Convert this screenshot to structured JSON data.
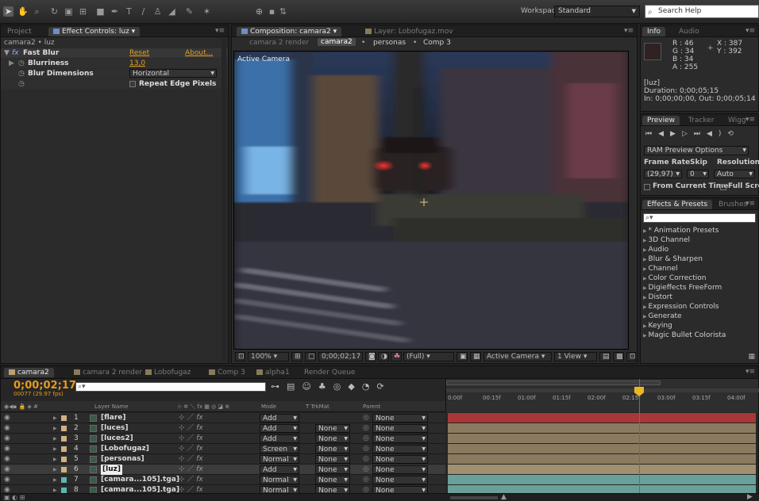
{
  "toolbar": {
    "tools": [
      "arrow-tool",
      "hand-tool",
      "zoom-tool",
      "rotate-tool",
      "camera-tool",
      "pan-tool",
      "rect-tool",
      "pen-tool",
      "type-tool",
      "brush-tool",
      "stamp-tool",
      "eraser-tool",
      "puppet-tool"
    ],
    "workspace_label": "Workspace:",
    "workspace_value": "Standard",
    "search_placeholder": "Search Help"
  },
  "effect_controls": {
    "tab_project": "Project",
    "tab_title": "Effect Controls: luz",
    "layer_path": "camara2 • luz",
    "effect_name": "Fast Blur",
    "reset": "Reset",
    "about": "About...",
    "prop1_name": "Blurriness",
    "prop1_value": "13,0",
    "prop2_name": "Blur Dimensions",
    "prop2_value": "Horizontal",
    "prop3_name": "Repeat Edge Pixels"
  },
  "composition": {
    "tab_title": "Composition: camara2",
    "tab_layer": "Layer: Lobofugaz.mov",
    "crumbs": [
      "camara 2 render",
      "camara2",
      "personas",
      "Comp 3"
    ],
    "active_camera_label": "Active Camera",
    "zoom": "100%",
    "timecode": "0;00;02;17",
    "resolution": "(Full)",
    "camera_view": "Active Camera",
    "views": "1 View"
  },
  "info": {
    "tab_info": "Info",
    "tab_audio": "Audio",
    "r": "R : 46",
    "g": "G : 34",
    "b": "B : 34",
    "a": "A : 255",
    "x": "X : 387",
    "y": "Y : 392",
    "layer": "[luz]",
    "duration": "Duration: 0;00;05;15",
    "inout": "In: 0;00;00;00, Out: 0;00;05;14",
    "swatch": "#2e2222"
  },
  "preview": {
    "tab_preview": "Preview",
    "tab_tracker": "Tracker",
    "tab_wiggler": "Wigg",
    "ram_options": "RAM Preview Options",
    "frame_rate_label": "Frame Rate",
    "skip_label": "Skip",
    "resolution_label": "Resolution",
    "frame_rate": "(29,97)",
    "skip": "0",
    "resolution": "Auto",
    "from_current": "From Current Time",
    "full_screen": "Full Scree"
  },
  "effects": {
    "tab_effects": "Effects & Presets",
    "tab_brushes": "Brushes",
    "items": [
      "* Animation Presets",
      "3D Channel",
      "Audio",
      "Blur & Sharpen",
      "Channel",
      "Color Correction",
      "Digieffects FreeForm",
      "Distort",
      "Expression Controls",
      "Generate",
      "Keying",
      "Magic Bullet Colorista"
    ]
  },
  "timeline": {
    "tabs": [
      "camara2",
      "camara 2 render",
      "Lobofugaz",
      "Comp 3",
      "alpha1",
      "Render Queue"
    ],
    "tab_colors": [
      "#b8a070",
      "#8a7a5a",
      "#8a7a5a",
      "#8a7a5a",
      "#8a7a5a",
      ""
    ],
    "timecode": "0;00;02;17",
    "frame_info": "00077 (29.97 fps)",
    "col_layer_name": "Layer Name",
    "col_mode": "Mode",
    "col_trkmat": "T  TrkMat",
    "col_parent": "Parent",
    "ruler": [
      "0:00f",
      "00:15f",
      "01:00f",
      "01:15f",
      "02:00f",
      "02:15f",
      "03:00f",
      "03:15f",
      "04:00f"
    ],
    "layers": [
      {
        "num": "1",
        "name": "[flare]",
        "mode": "Add",
        "trkmat": "",
        "parent": "None",
        "color": "#d0b080",
        "bar": "#a83838"
      },
      {
        "num": "2",
        "name": "[luces]",
        "mode": "Add",
        "trkmat": "None",
        "parent": "None",
        "color": "#d0b080",
        "bar": "#8a7a60"
      },
      {
        "num": "3",
        "name": "[luces2]",
        "mode": "Add",
        "trkmat": "None",
        "parent": "None",
        "color": "#d0b080",
        "bar": "#8a7a60"
      },
      {
        "num": "4",
        "name": "[Lobofugaz]",
        "mode": "Screen",
        "trkmat": "None",
        "parent": "None",
        "color": "#d0b080",
        "bar": "#8a7a60"
      },
      {
        "num": "5",
        "name": "[personas]",
        "mode": "Normal",
        "trkmat": "None",
        "parent": "None",
        "color": "#d0b080",
        "bar": "#8a7a60"
      },
      {
        "num": "6",
        "name": "[luz]",
        "mode": "Add",
        "trkmat": "None",
        "parent": "None",
        "color": "#d0b080",
        "bar": "#a09070"
      },
      {
        "num": "7",
        "name": "[camara...105].tga]",
        "mode": "Normal",
        "trkmat": "None",
        "parent": "None",
        "color": "#5bb8b0",
        "bar": "#6aa09a"
      },
      {
        "num": "8",
        "name": "[camara...105].tga]",
        "mode": "Normal",
        "trkmat": "None",
        "parent": "None",
        "color": "#5bb8b0",
        "bar": "#6aa09a"
      }
    ]
  }
}
